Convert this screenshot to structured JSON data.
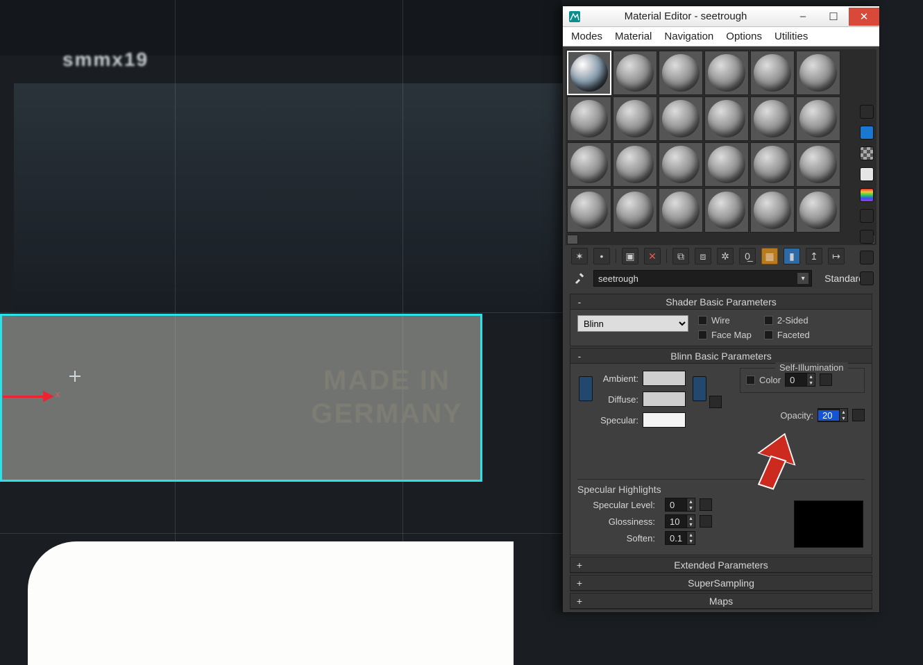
{
  "viewport": {
    "blur_text": "smmx19",
    "stamp_line1": "MADE IN",
    "stamp_line2": "GERMANY",
    "axis_label": "x"
  },
  "window": {
    "title": "Material Editor - seetrough",
    "minimize": "–",
    "maximize": "☐",
    "close": "✕"
  },
  "menus": [
    "Modes",
    "Material",
    "Navigation",
    "Options",
    "Utilities"
  ],
  "material": {
    "name": "seetrough",
    "type_button": "Standard"
  },
  "rollups": {
    "shader_basic": {
      "title": "Shader Basic Parameters",
      "toggle": "-",
      "shader": "Blinn",
      "checks": {
        "wire": "Wire",
        "two_sided": "2-Sided",
        "face_map": "Face Map",
        "faceted": "Faceted"
      }
    },
    "blinn_basic": {
      "title": "Blinn Basic Parameters",
      "toggle": "-",
      "labels": {
        "ambient": "Ambient:",
        "diffuse": "Diffuse:",
        "specular": "Specular:"
      },
      "self_illum": {
        "group": "Self-Illumination",
        "color_label": "Color",
        "color_value": "0"
      },
      "opacity": {
        "label": "Opacity:",
        "value": "20"
      },
      "spec_highlights": {
        "group": "Specular Highlights",
        "specular_level": {
          "label": "Specular Level:",
          "value": "0"
        },
        "glossiness": {
          "label": "Glossiness:",
          "value": "10"
        },
        "soften": {
          "label": "Soften:",
          "value": "0.1"
        }
      }
    },
    "extended": {
      "title": "Extended Parameters",
      "toggle": "+"
    },
    "supersampling": {
      "title": "SuperSampling",
      "toggle": "+"
    },
    "maps": {
      "title": "Maps",
      "toggle": "+"
    }
  }
}
